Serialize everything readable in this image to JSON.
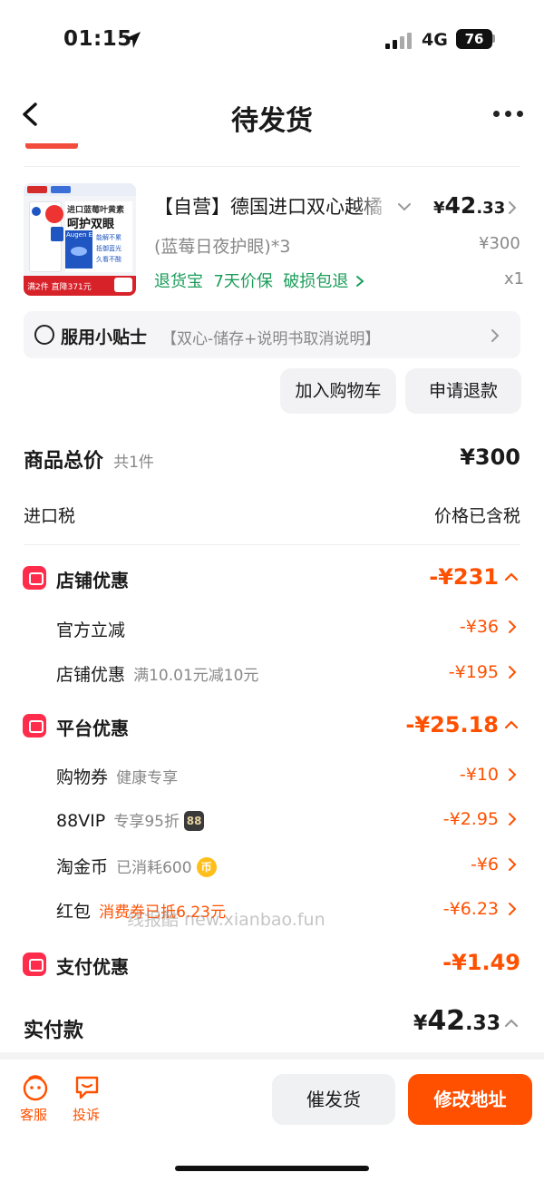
{
  "status_bar": {
    "time": "01:15",
    "network": "4G",
    "battery": "76"
  },
  "header": {
    "title": "待发货"
  },
  "product": {
    "title": "【自营】德国进口双心越橘",
    "spec": "(蓝莓日夜护眼)*3",
    "price_symbol": "¥",
    "price_int": "42",
    "price_dec": ".33",
    "original_price": "¥300",
    "tags": "退货宝  7天价保  破损包退",
    "quantity": "x1",
    "image_texts": {
      "headline": "进口蓝莓叶黄素",
      "main": "呵护双眼",
      "brand": "Augen Extra",
      "points": [
        "能解不累",
        "抵御蓝光",
        "久看不酸"
      ],
      "promo": "满2件 直降371元"
    }
  },
  "tips": {
    "label": "服用小贴士",
    "text": "【双心-储存+说明书取消说明】"
  },
  "actions": {
    "add_cart": "加入购物车",
    "refund": "申请退款"
  },
  "summary": {
    "total_label": "商品总价",
    "total_count": "共1件",
    "total_value": "¥300",
    "tax_label": "进口税",
    "tax_value": "价格已含税"
  },
  "discounts": {
    "shop": {
      "label": "店铺优惠",
      "value": "-¥231",
      "items": [
        {
          "label": "官方立减",
          "note": "",
          "value": "-¥36"
        },
        {
          "label": "店铺优惠",
          "note": "满10.01元减10元",
          "value": "-¥195"
        }
      ]
    },
    "platform": {
      "label": "平台优惠",
      "value": "-¥25.18",
      "items": [
        {
          "label": "购物券",
          "note": "健康专享",
          "value": "-¥10"
        },
        {
          "label": "88VIP",
          "note": "专享95折",
          "badge": "88",
          "value": "-¥2.95"
        },
        {
          "label": "淘金币",
          "note": "已消耗600",
          "badge": "币",
          "value": "-¥6"
        },
        {
          "label": "红包",
          "note": "消费券已抵6.23元",
          "value": "-¥6.23"
        }
      ]
    },
    "payment": {
      "label": "支付优惠",
      "value": "-¥1.49"
    }
  },
  "paid": {
    "label": "实付款",
    "symbol": "¥",
    "int": "42",
    "dec": ".33"
  },
  "watermark": "线报酷 new.xianbao.fun",
  "bottom": {
    "service": "客服",
    "complain": "投诉",
    "urge": "催发货",
    "change_address": "修改地址"
  },
  "colors": {
    "accent": "#ff5000",
    "green": "#1b9d5a",
    "red_icon": "#ff2d4b"
  }
}
